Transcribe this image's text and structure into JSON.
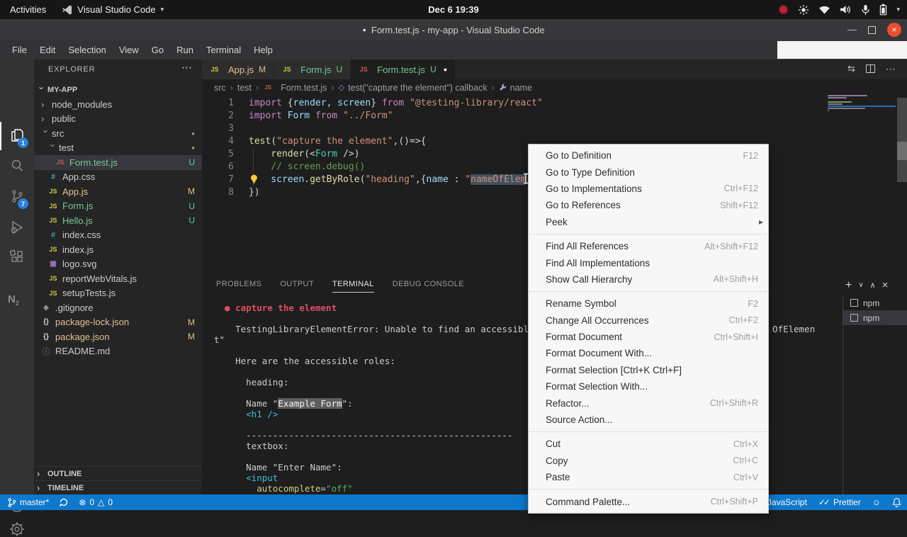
{
  "system_bar": {
    "activities": "Activities",
    "app_name": "Visual Studio Code",
    "clock": "Dec 6 19:39"
  },
  "title_bar": {
    "title": "Form.test.js - my-app - Visual Studio Code"
  },
  "menu_bar": [
    "File",
    "Edit",
    "Selection",
    "View",
    "Go",
    "Run",
    "Terminal",
    "Help"
  ],
  "activity_bar": {
    "explorer_badge": "1",
    "scm_badge": "7",
    "extension_label": "N"
  },
  "explorer": {
    "header": "EXPLORER",
    "root": "MY-APP",
    "tree": [
      {
        "label": "node_modules",
        "kind": "folder",
        "indent": 0
      },
      {
        "label": "public",
        "kind": "folder",
        "indent": 0
      },
      {
        "label": "src",
        "kind": "folder",
        "indent": 0,
        "open": true,
        "badge": "dot"
      },
      {
        "label": "test",
        "kind": "folder",
        "indent": 1,
        "open": true,
        "badge": "dot"
      },
      {
        "label": "Form.test.js",
        "kind": "js-test",
        "indent": 2,
        "badge": "U",
        "git": "u",
        "selected": true
      },
      {
        "label": "App.css",
        "kind": "css",
        "indent": 1
      },
      {
        "label": "App.js",
        "kind": "js",
        "indent": 1,
        "badge": "M",
        "git": "m"
      },
      {
        "label": "Form.js",
        "kind": "js",
        "indent": 1,
        "badge": "U",
        "git": "u"
      },
      {
        "label": "Hello.js",
        "kind": "js",
        "indent": 1,
        "badge": "U",
        "git": "u"
      },
      {
        "label": "index.css",
        "kind": "css",
        "indent": 1
      },
      {
        "label": "index.js",
        "kind": "js",
        "indent": 1
      },
      {
        "label": "logo.svg",
        "kind": "svg",
        "indent": 1
      },
      {
        "label": "reportWebVitals.js",
        "kind": "js",
        "indent": 1
      },
      {
        "label": "setupTests.js",
        "kind": "js",
        "indent": 1
      },
      {
        "label": ".gitignore",
        "kind": "git",
        "indent": 0
      },
      {
        "label": "package-lock.json",
        "kind": "json",
        "indent": 0,
        "badge": "M",
        "git": "m"
      },
      {
        "label": "package.json",
        "kind": "json",
        "indent": 0,
        "badge": "M",
        "git": "m"
      },
      {
        "label": "README.md",
        "kind": "md",
        "indent": 0
      }
    ],
    "outline": "OUTLINE",
    "timeline": "TIMELINE"
  },
  "tabs": [
    {
      "label": "App.js",
      "status": "M",
      "git": "m",
      "icon": "js"
    },
    {
      "label": "Form.js",
      "status": "U",
      "git": "u",
      "icon": "js"
    },
    {
      "label": "Form.test.js",
      "status": "U",
      "git": "u",
      "icon": "js-test",
      "active": true,
      "dirty": true
    }
  ],
  "breadcrumb": {
    "items": [
      "src",
      "test",
      "Form.test.js",
      "test(\"capture the element\") callback",
      "name"
    ]
  },
  "editor": {
    "lines": [
      [
        [
          "kw",
          "import "
        ],
        [
          "pn",
          "{"
        ],
        [
          "var",
          "render, screen"
        ],
        [
          "pn",
          "} "
        ],
        [
          "kw",
          "from "
        ],
        [
          "str",
          "\"@testing-library/react\""
        ]
      ],
      [
        [
          "kw",
          "import "
        ],
        [
          "var",
          "Form "
        ],
        [
          "kw",
          "from "
        ],
        [
          "str",
          "\"../Form\""
        ]
      ],
      [],
      [
        [
          "fn",
          "test"
        ],
        [
          "pn",
          "("
        ],
        [
          "str",
          "\"capture the element\""
        ],
        [
          "pn",
          ",()=>{"
        ]
      ],
      [
        [
          "pn",
          "    "
        ],
        [
          "fn",
          "render"
        ],
        [
          "pn",
          "(<"
        ],
        [
          "cls",
          "Form"
        ],
        [
          "pn",
          " />)"
        ]
      ],
      [
        [
          "cmt",
          "    // screen.debug()"
        ]
      ],
      [
        [
          "var",
          "    screen"
        ],
        [
          "pn",
          "."
        ],
        [
          "fn",
          "getByRole"
        ],
        [
          "pn",
          "("
        ],
        [
          "str",
          "\"heading\""
        ],
        [
          "pn",
          ",{"
        ],
        [
          "var",
          "name"
        ],
        [
          "pn",
          " : "
        ],
        [
          "str",
          "\""
        ],
        [
          "strsel",
          "nameOfElem"
        ]
      ],
      [
        [
          "pn",
          "})"
        ]
      ]
    ]
  },
  "panel": {
    "tabs": [
      "PROBLEMS",
      "OUTPUT",
      "TERMINAL",
      "DEBUG CONSOLE"
    ],
    "active_tab": "TERMINAL",
    "terminals": [
      {
        "label": "npm"
      },
      {
        "label": "npm",
        "selected": true
      }
    ],
    "terminal_lines": [
      [
        [
          "r",
          "  ● capture the element"
        ]
      ],
      [],
      [
        [
          "d",
          "    TestingLibraryElementError: Unable to find an accessibl"
        ],
        [
          "sp",
          ""
        ],
        [
          "d",
          "OfElemen"
        ]
      ],
      [
        [
          "d",
          "t\""
        ]
      ],
      [],
      [
        [
          "d",
          "    Here are the accessible roles:"
        ]
      ],
      [],
      [
        [
          "d",
          "      heading:"
        ]
      ],
      [],
      [
        [
          "d",
          "      Name \""
        ],
        [
          "hl",
          "Example Form"
        ],
        [
          "d",
          "\":"
        ]
      ],
      [
        [
          "cy",
          "      <h1 />"
        ]
      ],
      [],
      [
        [
          "d",
          "      --------------------------------------------------"
        ]
      ],
      [
        [
          "d",
          "      textbox:"
        ]
      ],
      [],
      [
        [
          "d",
          "      Name \"Enter Name\":"
        ]
      ],
      [
        [
          "cy",
          "      <input"
        ]
      ],
      [
        [
          "at",
          "        autocomplete"
        ],
        [
          "d",
          "="
        ],
        [
          "vl",
          "\"off\""
        ]
      ]
    ]
  },
  "context_menu": {
    "groups": [
      [
        {
          "label": "Go to Definition",
          "shortcut": "F12"
        },
        {
          "label": "Go to Type Definition"
        },
        {
          "label": "Go to Implementations",
          "shortcut": "Ctrl+F12"
        },
        {
          "label": "Go to References",
          "shortcut": "Shift+F12"
        },
        {
          "label": "Peek",
          "submenu": true
        }
      ],
      [
        {
          "label": "Find All References",
          "shortcut": "Alt+Shift+F12"
        },
        {
          "label": "Find All Implementations"
        },
        {
          "label": "Show Call Hierarchy",
          "shortcut": "Alt+Shift+H"
        }
      ],
      [
        {
          "label": "Rename Symbol",
          "shortcut": "F2"
        },
        {
          "label": "Change All Occurrences",
          "shortcut": "Ctrl+F2"
        },
        {
          "label": "Format Document",
          "shortcut": "Ctrl+Shift+I"
        },
        {
          "label": "Format Document With..."
        },
        {
          "label": "Format Selection [Ctrl+K Ctrl+F]"
        },
        {
          "label": "Format Selection With..."
        },
        {
          "label": "Refactor...",
          "shortcut": "Ctrl+Shift+R"
        },
        {
          "label": "Source Action..."
        }
      ],
      [
        {
          "label": "Cut",
          "shortcut": "Ctrl+X"
        },
        {
          "label": "Copy",
          "shortcut": "Ctrl+C"
        },
        {
          "label": "Paste",
          "shortcut": "Ctrl+V"
        }
      ],
      [
        {
          "label": "Command Palette...",
          "shortcut": "Ctrl+Shift+P"
        }
      ]
    ]
  },
  "status_bar": {
    "branch": "master*",
    "errors": "0",
    "warnings": "0",
    "language": "JavaScript",
    "checks": "✓✓",
    "formatter": "Prettier"
  },
  "icons": {
    "more": "⋯",
    "chevron": "›",
    "expand": "▾",
    "minimize": "—",
    "close_x": "×",
    "plus": "+",
    "panel_chevron_down": "∨",
    "panel_chevron_up": "∧",
    "dot": "●",
    "error": "⊗",
    "warning": "△",
    "smiley": "☺",
    "submenu_arrow": "▸",
    "file_glyphs": {
      "js": "JS",
      "js-test": "JS",
      "css": "#",
      "json": "{}",
      "svg": "▦",
      "git": "◆",
      "md": "ⓘ"
    }
  }
}
